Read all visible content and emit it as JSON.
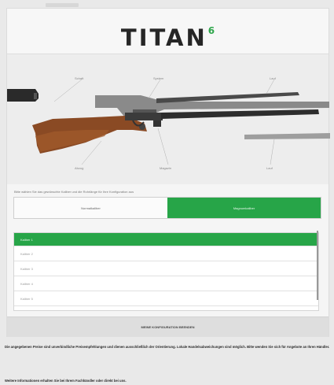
{
  "brand": {
    "name": "TITAN",
    "version": "6"
  },
  "parts": {
    "schaft": "Schaft",
    "system": "System",
    "lauf_top": "Lauf",
    "abzug": "Abzug",
    "magazin": "Magazin",
    "lauf_bottom": "Lauf"
  },
  "instruction": "Bitte wählen Sie das gewünschte Kaliber und die Rohrlänge für Ihre Konfiguration aus",
  "toggle": {
    "left_label": "Normalkaliber",
    "right_label": "Magnumkaliber"
  },
  "calibers": [
    {
      "label": "Kaliber 1",
      "selected": true
    },
    {
      "label": "Kaliber 2",
      "selected": false
    },
    {
      "label": "Kaliber 3",
      "selected": false
    },
    {
      "label": "Kaliber 4",
      "selected": false
    },
    {
      "label": "Kaliber 5",
      "selected": false
    }
  ],
  "finish_button": "MEINE KONFIGURATION BEENDEN",
  "disclaimer": "Die angegebenen Preise sind unverbindliche Preisempfehlungen und dienen ausschließlich der Orientierung. Lokale Handelsabweichungen sind möglich. Bitte wenden Sie sich für Angebote an Ihren Händler.",
  "disclaimer2": "Weitere Informationen erhalten Sie bei Ihrem Fachhändler oder direkt bei uns."
}
